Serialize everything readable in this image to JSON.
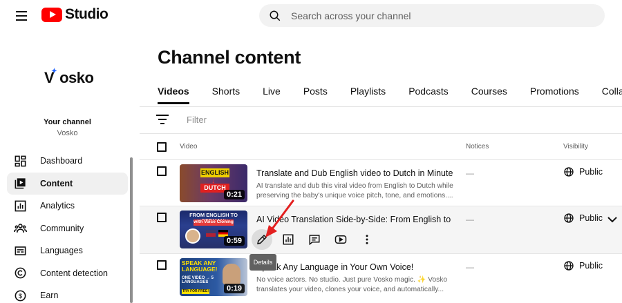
{
  "header": {
    "logo_text": "Studio",
    "search_placeholder": "Search across your channel"
  },
  "channel": {
    "logo_text": "Vosko",
    "your_channel_label": "Your channel",
    "name": "Vosko"
  },
  "sidebar": {
    "items": [
      {
        "label": "Dashboard",
        "icon": "dashboard-icon"
      },
      {
        "label": "Content",
        "icon": "content-icon",
        "active": true
      },
      {
        "label": "Analytics",
        "icon": "analytics-icon"
      },
      {
        "label": "Community",
        "icon": "community-icon"
      },
      {
        "label": "Languages",
        "icon": "languages-icon"
      },
      {
        "label": "Content detection",
        "icon": "copyright-icon"
      },
      {
        "label": "Earn",
        "icon": "dollar-icon"
      }
    ]
  },
  "page": {
    "title": "Channel content",
    "tabs": [
      "Videos",
      "Shorts",
      "Live",
      "Posts",
      "Playlists",
      "Podcasts",
      "Courses",
      "Promotions",
      "Collab"
    ],
    "active_tab": "Videos",
    "filter_placeholder": "Filter"
  },
  "table": {
    "columns": {
      "video": "Video",
      "notices": "Notices",
      "visibility": "Visibility"
    },
    "rows": [
      {
        "title": "Translate and Dub English video to Dutch in Minutes",
        "description": "AI translate and dub this viral video from English to Dutch while preserving the baby's unique voice pitch, tone, and emotions....",
        "duration": "0:21",
        "notice": "—",
        "visibility": "Public",
        "thumb_text": [
          "ENGLISH",
          "DUTCH"
        ]
      },
      {
        "title": "AI Video Translation Side-by-Side: From English to Ger...",
        "description": "",
        "duration": "0:59",
        "notice": "—",
        "visibility": "Public",
        "thumb_text": [
          "FROM ENGLISH TO GERMAN!",
          "with Voice Cloning"
        ]
      },
      {
        "title": "Speak Any Language in Your Own Voice!",
        "description": "No voice actors. No studio. Just pure Vosko magic. ✨ Vosko translates your video, clones your voice, and automatically...",
        "duration": "0:19",
        "notice": "—",
        "visibility": "Public",
        "thumb_text": [
          "SPEAK ANY LANGUAGE!",
          "ONE VIDEO → 5 LANGUAGES",
          "TRY FOR FREE!"
        ]
      }
    ]
  },
  "tooltip": {
    "text": "Details"
  },
  "colors": {
    "brand_red": "#ff0000",
    "annotation_arrow": "#e32020"
  }
}
